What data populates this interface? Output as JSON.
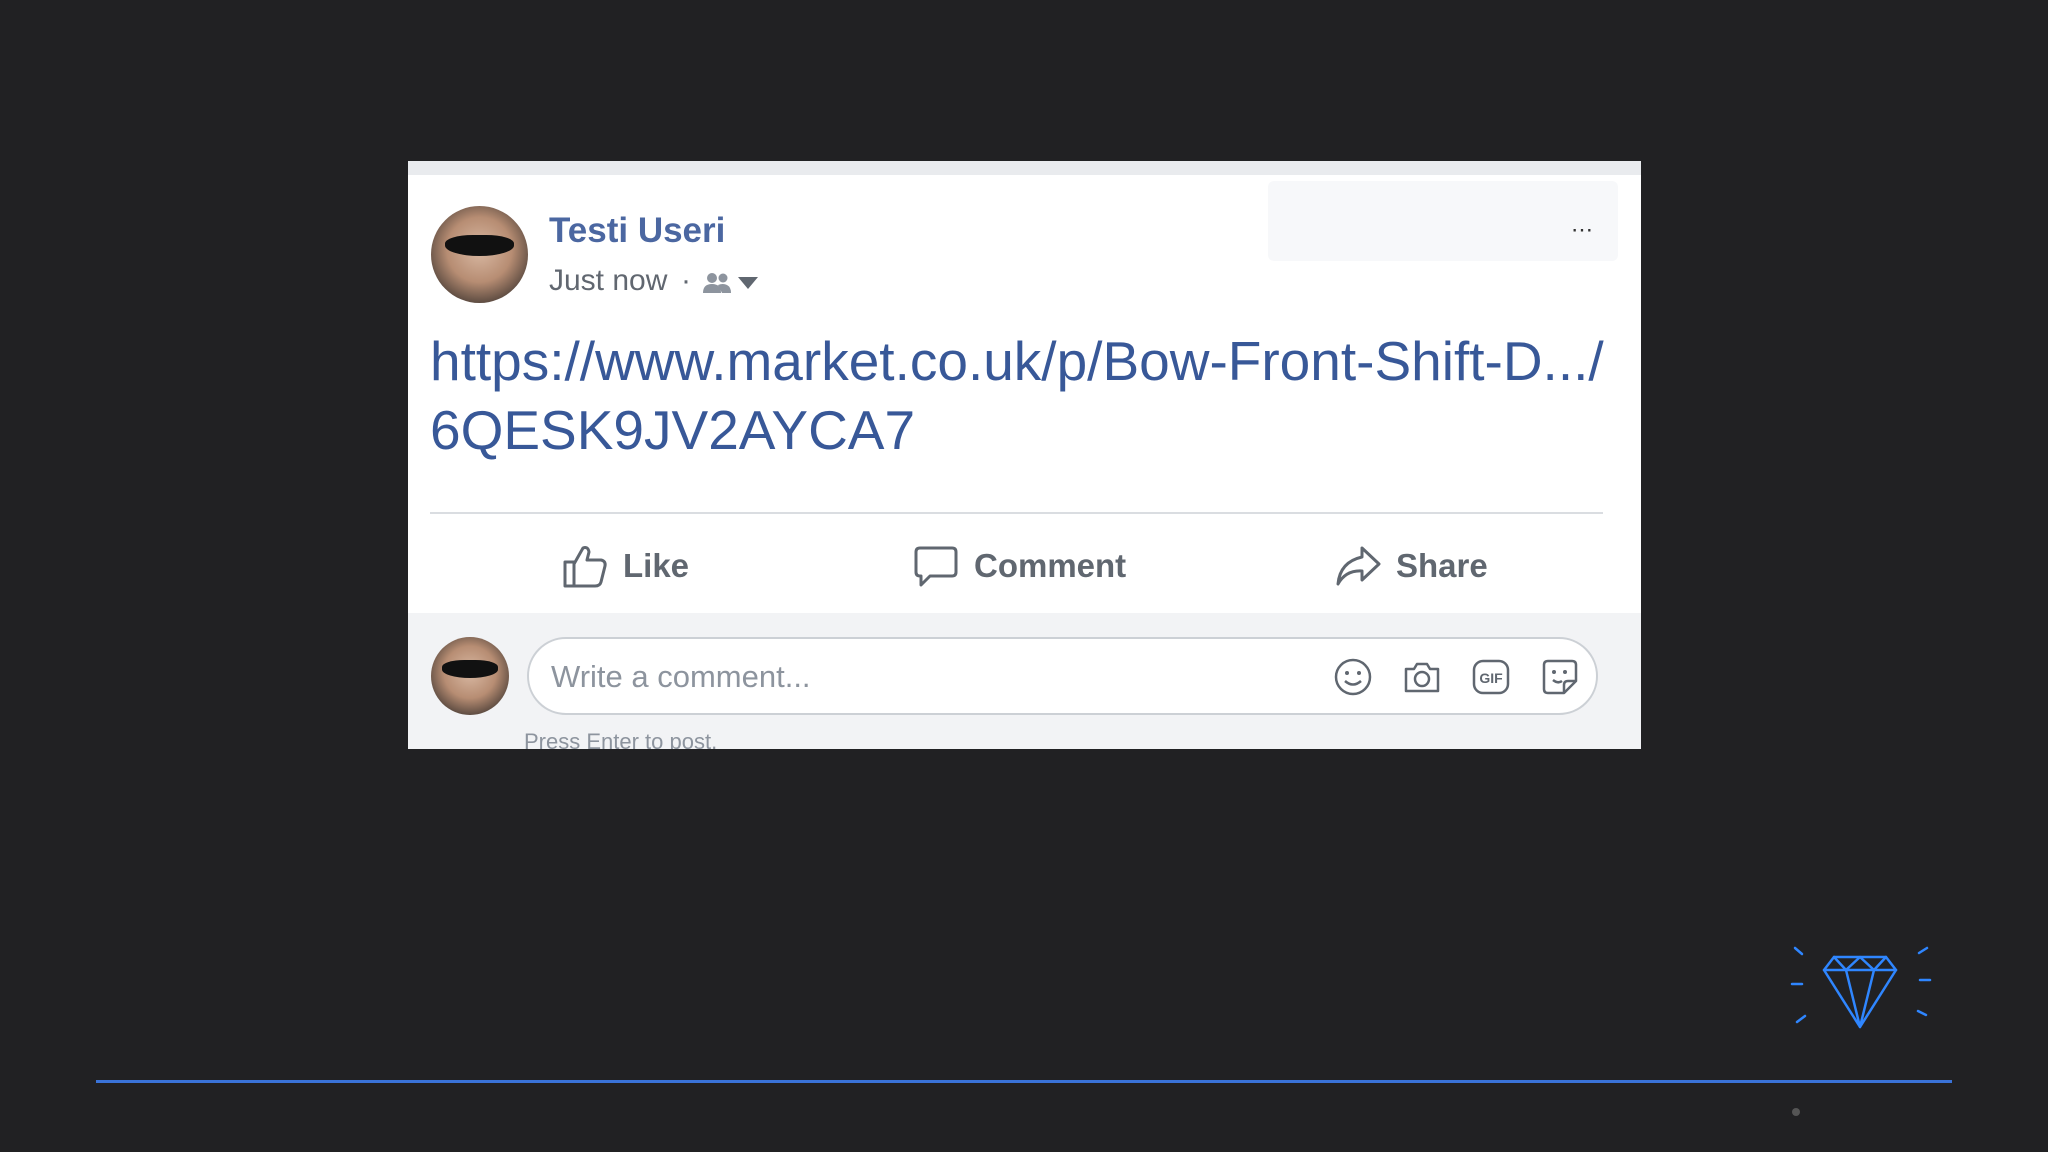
{
  "post": {
    "author": "Testi Useri",
    "timestamp": "Just now",
    "separator": "·",
    "audience_icon": "friends-icon",
    "link_text": "https://www.market.co.uk/p/Bow-Front-Shift-D.../6QESK9JV2AYCA7"
  },
  "actions": {
    "like_label": "Like",
    "comment_label": "Comment",
    "share_label": "Share"
  },
  "comment_box": {
    "placeholder": "Write a comment...",
    "hint": "Press Enter to post.",
    "icons": [
      "emoji-icon",
      "camera-icon",
      "gif-icon",
      "sticker-icon"
    ]
  },
  "colors": {
    "background": "#212123",
    "author_name": "#4b67a1",
    "link": "#385898",
    "footer_line": "#3a73d8",
    "logo": "#2f86ff"
  }
}
